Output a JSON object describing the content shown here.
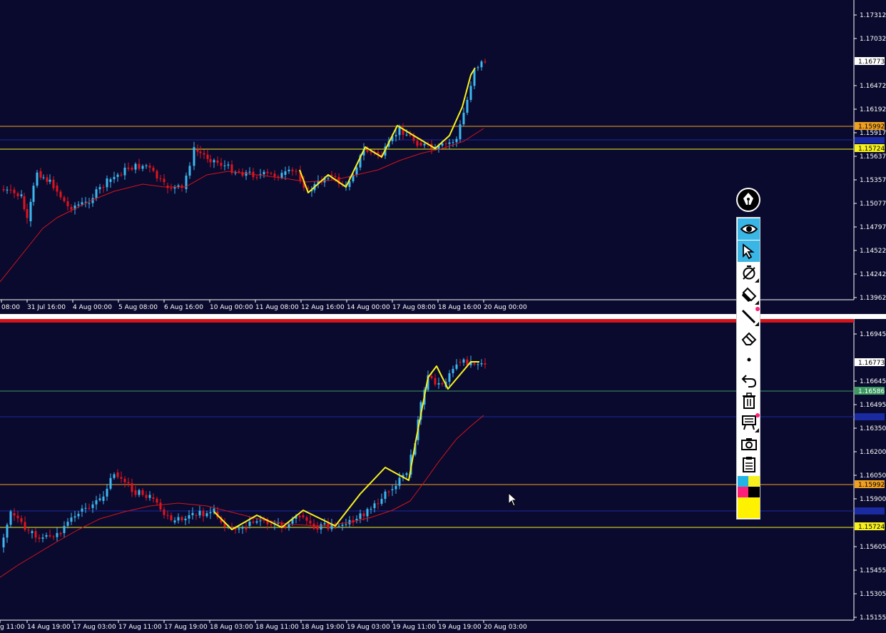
{
  "colors": {
    "background": "#0a0a2e",
    "axis_text": "#ffffff",
    "bull_candle": "#3db8f0",
    "bear_candle": "#e0141e",
    "ma_line": "#d4141a",
    "zigzag": "#f7f21e",
    "level_orange": "#f0a020",
    "level_yellow": "#f7f21e",
    "level_green": "#3a9a60",
    "level_blue": "#1a2aa0",
    "toolbar_active": "#39b6e6"
  },
  "top_chart": {
    "price_axis": {
      "labels": [
        "1.17312",
        "1.17032",
        "1.16472",
        "1.16192",
        "1.15917",
        "1.15637",
        "1.15357",
        "1.15077",
        "1.14797",
        "1.14522",
        "1.14242",
        "1.13962"
      ],
      "current_price": "1.16773",
      "level_1_tag": "1.15992",
      "level_2_tag": "1.15724"
    },
    "time_axis": [
      "08:00",
      "31 Jul 16:00",
      "4 Aug 00:00",
      "5 Aug 08:00",
      "6 Aug 16:00",
      "10 Aug 00:00",
      "11 Aug 08:00",
      "12 Aug 16:00",
      "14 Aug 00:00",
      "17 Aug 08:00",
      "18 Aug 16:00",
      "20 Aug 00:00"
    ]
  },
  "bottom_chart": {
    "price_axis": {
      "labels": [
        "1.16945",
        "1.16645",
        "1.16495",
        "1.16350",
        "1.16200",
        "1.16050",
        "1.15900",
        "1.15605",
        "1.15455",
        "1.15305",
        "1.15155"
      ],
      "current_price": "1.16773",
      "level_green_tag": "1.16586",
      "level_orange_tag": "1.15992",
      "level_yellow_tag": "1.15724"
    },
    "time_axis": [
      "g 11:00",
      "14 Aug 19:00",
      "17 Aug 03:00",
      "17 Aug 11:00",
      "17 Aug 19:00",
      "18 Aug 03:00",
      "18 Aug 11:00",
      "18 Aug 19:00",
      "19 Aug 03:00",
      "19 Aug 11:00",
      "19 Aug 19:00",
      "20 Aug 03:00"
    ]
  },
  "toolbar": {
    "tools": [
      "eye-icon",
      "cursor-arrow-icon",
      "timer-icon",
      "highlighter-icon",
      "pen-line-icon",
      "eraser-icon",
      "dot-size-icon",
      "undo-icon",
      "trash-icon",
      "delete-all-icon",
      "camera-icon",
      "clipboard-icon"
    ],
    "palette": [
      "#22b4e6",
      "#f7f21e",
      "#ff1e78",
      "#000000",
      "#fff200"
    ]
  }
}
